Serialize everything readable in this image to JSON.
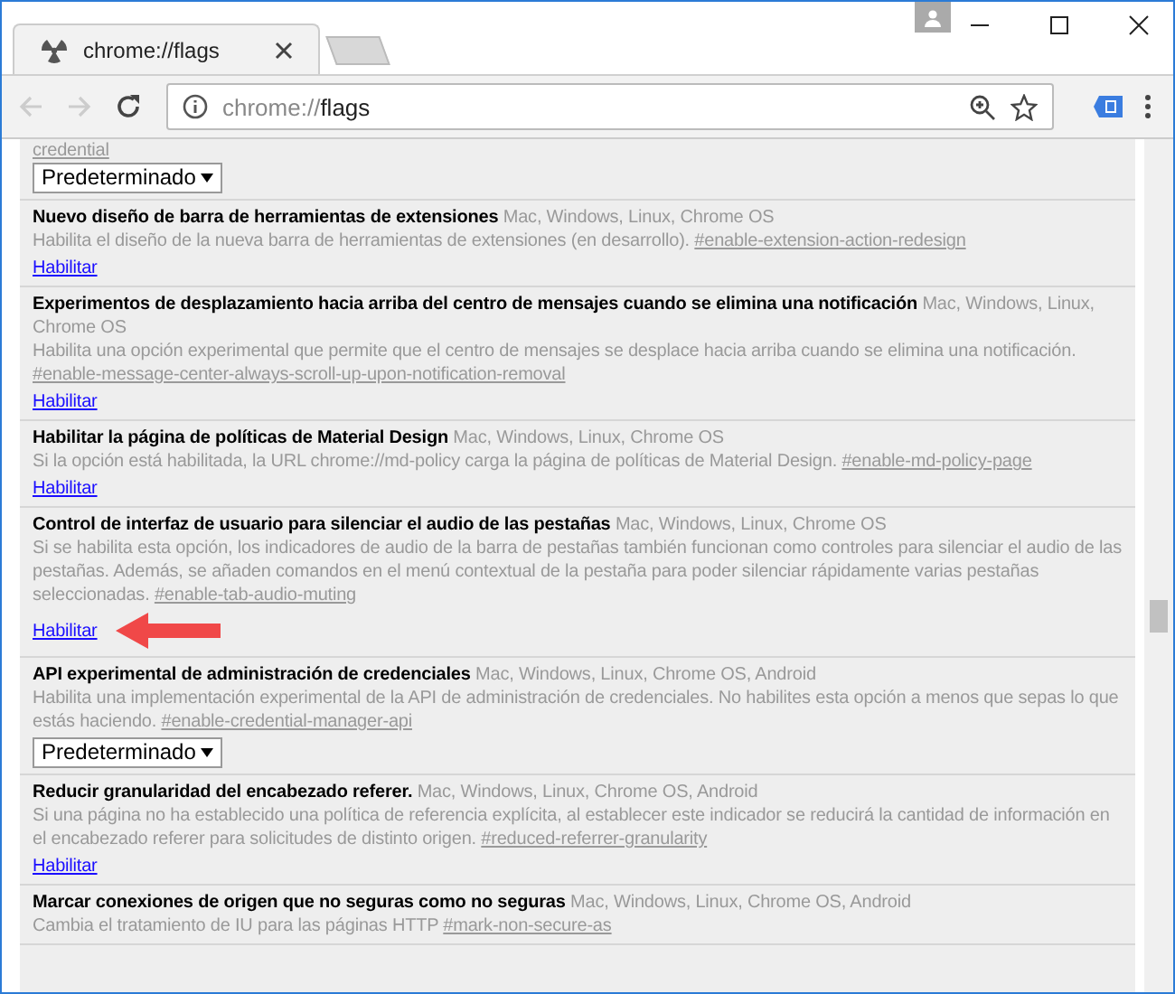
{
  "tab": {
    "title": "chrome://flags",
    "selected": true
  },
  "address_bar": {
    "scheme": "chrome://",
    "path": "flags"
  },
  "top_partial": {
    "link": "credential",
    "select": "Predeterminado"
  },
  "experiments": [
    {
      "title": "Nuevo diseño de barra de herramientas de extensiones",
      "platforms": "Mac, Windows, Linux, Chrome OS",
      "description": "Habilita el diseño de la nueva barra de herramientas de extensiones (en desarrollo).",
      "link": "#enable-extension-action-redesign",
      "action": {
        "kind": "link",
        "label": "Habilitar"
      }
    },
    {
      "title": "Experimentos de desplazamiento hacia arriba del centro de mensajes cuando se elimina una notificación",
      "platforms": "Mac, Windows, Linux, Chrome OS",
      "description": "Habilita una opción experimental que permite que el centro de mensajes se desplace hacia arriba cuando se elimina una notificación.",
      "link": "#enable-message-center-always-scroll-up-upon-notification-removal",
      "action": {
        "kind": "link",
        "label": "Habilitar"
      }
    },
    {
      "title": "Habilitar la página de políticas de Material Design",
      "platforms": "Mac, Windows, Linux, Chrome OS",
      "description": "Si la opción está habilitada, la URL chrome://md-policy carga la página de políticas de Material Design.",
      "link": "#enable-md-policy-page",
      "action": {
        "kind": "link",
        "label": "Habilitar"
      }
    },
    {
      "title": "Control de interfaz de usuario para silenciar el audio de las pestañas",
      "platforms": "Mac, Windows, Linux, Chrome OS",
      "description": "Si se habilita esta opción, los indicadores de audio de la barra de pestañas también funcionan como controles para silenciar el audio de las pestañas. Además, se añaden comandos en el menú contextual de la pestaña para poder silenciar rápidamente varias pestañas seleccionadas.",
      "link": "#enable-tab-audio-muting",
      "action": {
        "kind": "link",
        "label": "Habilitar"
      },
      "pointed": true
    },
    {
      "title": "API experimental de administración de credenciales",
      "platforms": "Mac, Windows, Linux, Chrome OS, Android",
      "description": "Habilita una implementación experimental de la API de administración de credenciales. No habilites esta opción a menos que sepas lo que estás haciendo.",
      "link": "#enable-credential-manager-api",
      "action": {
        "kind": "select",
        "label": "Predeterminado"
      }
    },
    {
      "title": "Reducir granularidad del encabezado referer.",
      "platforms": "Mac, Windows, Linux, Chrome OS, Android",
      "description": "Si una página no ha establecido una política de referencia explícita, al establecer este indicador se reducirá la cantidad de información en el encabezado referer para solicitudes de distinto origen.",
      "link": "#reduced-referrer-granularity",
      "action": {
        "kind": "link",
        "label": "Habilitar"
      }
    },
    {
      "title": "Marcar conexiones de origen que no seguras como no seguras",
      "platforms": "Mac, Windows, Linux, Chrome OS, Android",
      "description": "Cambia el tratamiento de IU para las páginas HTTP",
      "link": "#mark-non-secure-as"
    }
  ]
}
